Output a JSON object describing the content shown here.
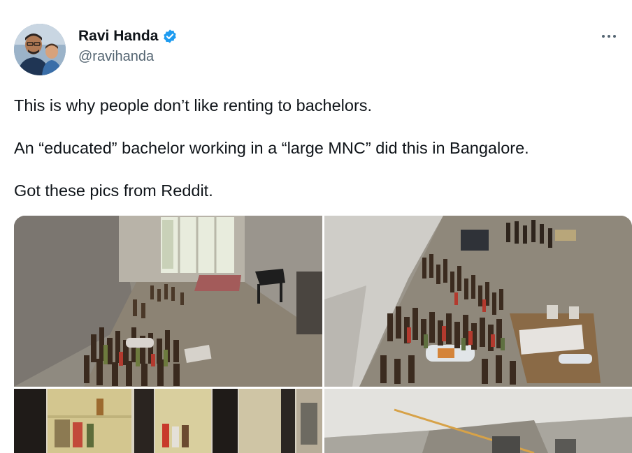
{
  "author": {
    "display_name": "Ravi Handa",
    "handle": "@ravihanda",
    "verified": true,
    "verified_color": "#1d9bf0"
  },
  "tweet": {
    "paragraphs": [
      "This is why people don’t like renting to bachelors.",
      "An “educated” bachelor working in a “large MNC” did this in Bangalore.",
      "Got these pics from Reddit."
    ]
  },
  "media": {
    "photo_count": 4
  },
  "icons": {
    "more": "more-options-icon",
    "verified": "verified-badge-icon"
  }
}
